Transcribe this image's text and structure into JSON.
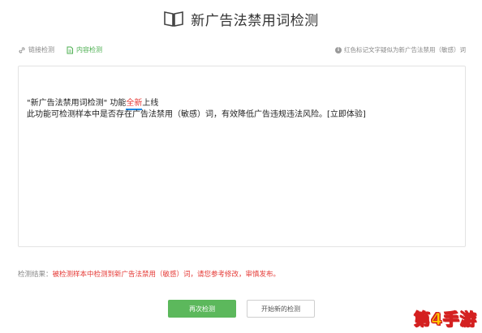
{
  "header": {
    "title": "新广告法禁用词检测",
    "icon": "book-icon"
  },
  "tabs": [
    {
      "label": "链接检测",
      "icon": "link-icon",
      "active": false
    },
    {
      "label": "内容检测",
      "icon": "document-icon",
      "active": true
    }
  ],
  "hint": {
    "icon": "info-icon",
    "text": "红色标记文字疑似为新广告法禁用（敏感）词"
  },
  "editor": {
    "line1_before": "\"新广告法禁用词检测\"  功能",
    "line1_highlight": "全新",
    "line1_after": "上线",
    "line2": "此功能可检测样本中是否存在广告法禁用（敏感）词，有效降低广告违规违法风险。[立即体验]"
  },
  "result": {
    "label": "检测结果：",
    "message": "被检测样本中检测到新广告法禁用（敏感）词，请您参考修改，审慎发布。"
  },
  "buttons": {
    "recheck": "再次检测",
    "new_check": "开始新的检测"
  },
  "watermark": {
    "text": "第4手游"
  },
  "colors": {
    "accent": "#5cb85c",
    "warning": "#e53935",
    "underline": "#1e88e5"
  }
}
